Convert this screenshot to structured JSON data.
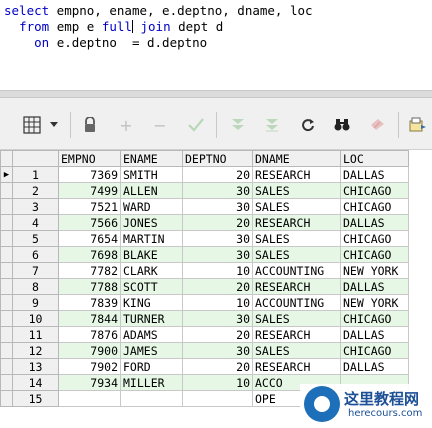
{
  "editor": {
    "line1": {
      "kw": "select",
      "rest": " empno, ename, e.deptno, dname, loc"
    },
    "line2": {
      "kw1": "from",
      "mid1": " emp e ",
      "kw2": "full",
      "kw3": "join",
      "rest": " dept d"
    },
    "line3": {
      "kw": "on",
      "rest": " e.deptno  = d.deptno"
    }
  },
  "toolbar": {
    "icons": [
      "grid-layout-icon",
      "dropdown-arrow-icon",
      "lock-icon",
      "add-row-icon",
      "delete-row-icon",
      "post-check-icon",
      "filter-down-icon",
      "filter-down-icon-2",
      "refresh-icon",
      "find-binoculars-icon",
      "clear-eraser-icon",
      "export-icon"
    ]
  },
  "grid": {
    "columns": [
      "EMPNO",
      "ENAME",
      "DEPTNO",
      "DNAME",
      "LOC"
    ],
    "rows": [
      {
        "n": "1",
        "empno": "7369",
        "ename": "SMITH",
        "deptno": "20",
        "dname": "RESEARCH",
        "loc": "DALLAS"
      },
      {
        "n": "2",
        "empno": "7499",
        "ename": "ALLEN",
        "deptno": "30",
        "dname": "SALES",
        "loc": "CHICAGO"
      },
      {
        "n": "3",
        "empno": "7521",
        "ename": "WARD",
        "deptno": "30",
        "dname": "SALES",
        "loc": "CHICAGO"
      },
      {
        "n": "4",
        "empno": "7566",
        "ename": "JONES",
        "deptno": "20",
        "dname": "RESEARCH",
        "loc": "DALLAS"
      },
      {
        "n": "5",
        "empno": "7654",
        "ename": "MARTIN",
        "deptno": "30",
        "dname": "SALES",
        "loc": "CHICAGO"
      },
      {
        "n": "6",
        "empno": "7698",
        "ename": "BLAKE",
        "deptno": "30",
        "dname": "SALES",
        "loc": "CHICAGO"
      },
      {
        "n": "7",
        "empno": "7782",
        "ename": "CLARK",
        "deptno": "10",
        "dname": "ACCOUNTING",
        "loc": "NEW YORK"
      },
      {
        "n": "8",
        "empno": "7788",
        "ename": "SCOTT",
        "deptno": "20",
        "dname": "RESEARCH",
        "loc": "DALLAS"
      },
      {
        "n": "9",
        "empno": "7839",
        "ename": "KING",
        "deptno": "10",
        "dname": "ACCOUNTING",
        "loc": "NEW YORK"
      },
      {
        "n": "10",
        "empno": "7844",
        "ename": "TURNER",
        "deptno": "30",
        "dname": "SALES",
        "loc": "CHICAGO"
      },
      {
        "n": "11",
        "empno": "7876",
        "ename": "ADAMS",
        "deptno": "20",
        "dname": "RESEARCH",
        "loc": "DALLAS"
      },
      {
        "n": "12",
        "empno": "7900",
        "ename": "JAMES",
        "deptno": "30",
        "dname": "SALES",
        "loc": "CHICAGO"
      },
      {
        "n": "13",
        "empno": "7902",
        "ename": "FORD",
        "deptno": "20",
        "dname": "RESEARCH",
        "loc": "DALLAS"
      },
      {
        "n": "14",
        "empno": "7934",
        "ename": "MILLER",
        "deptno": "10",
        "dname": "ACCO",
        "loc": ""
      },
      {
        "n": "15",
        "empno": "",
        "ename": "",
        "deptno": "",
        "dname": "OPE",
        "loc": ""
      }
    ]
  },
  "watermark": {
    "title": "这里教程网",
    "url": "herecours.com"
  },
  "colors": {
    "keyword": "#0000c8",
    "alt_row": "#e6f7e6",
    "header_bg": "#f0f0f0"
  }
}
